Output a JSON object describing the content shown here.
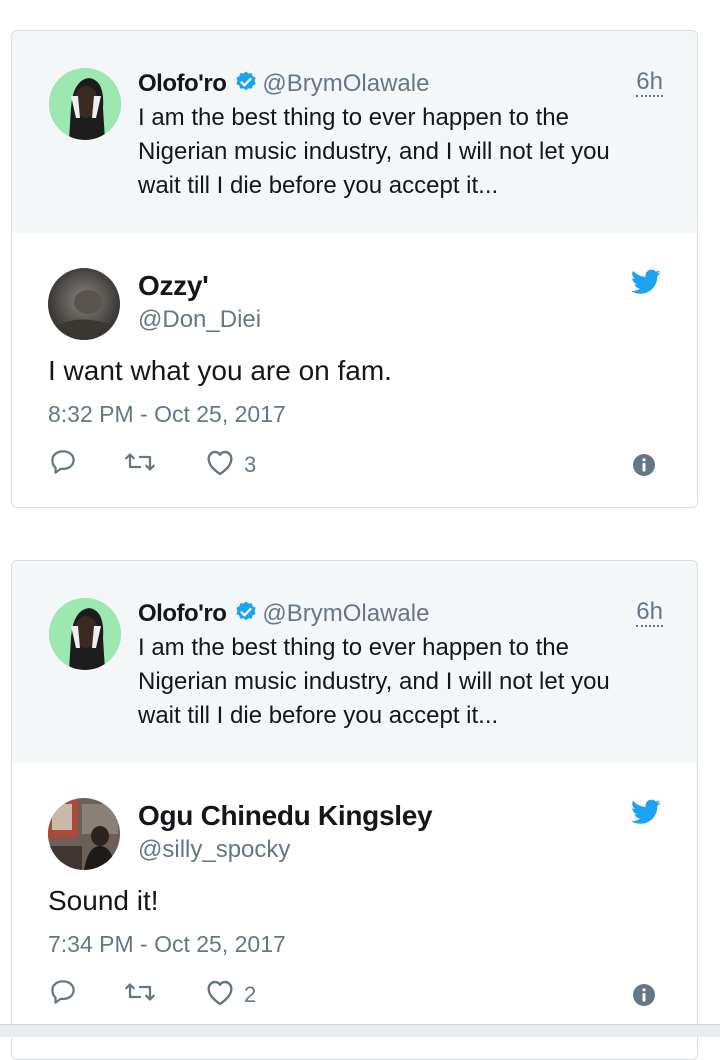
{
  "tweets": [
    {
      "quoted": {
        "name": "Olofo'ro",
        "handle": "@BrymOlawale",
        "time": "6h",
        "text": "I am the best thing to ever happen to the Nigerian music industry, and I will not let you wait till I die before you accept it..."
      },
      "reply": {
        "name": "Ozzy'",
        "handle": "@Don_Diei",
        "text": "I want what you are on fam.",
        "date": "8:32 PM - Oct 25, 2017",
        "likes": "3"
      }
    },
    {
      "quoted": {
        "name": "Olofo'ro",
        "handle": "@BrymOlawale",
        "time": "6h",
        "text": "I am the best thing to ever happen to the Nigerian music industry, and I will not let you wait till I die before you accept it..."
      },
      "reply": {
        "name": "Ogu Chinedu Kingsley",
        "handle": "@silly_spocky",
        "text": "Sound it!",
        "date": "7:34 PM - Oct 25, 2017",
        "likes": "2"
      }
    }
  ],
  "colors": {
    "twitter_blue": "#1da1f2",
    "secondary_text": "#657786",
    "quoted_bg": "#f3f7f8",
    "card_border": "#d6dde3"
  },
  "icons": [
    "verified-badge-icon",
    "twitter-bird-icon",
    "reply-icon",
    "retweet-icon",
    "like-heart-icon",
    "info-icon"
  ]
}
